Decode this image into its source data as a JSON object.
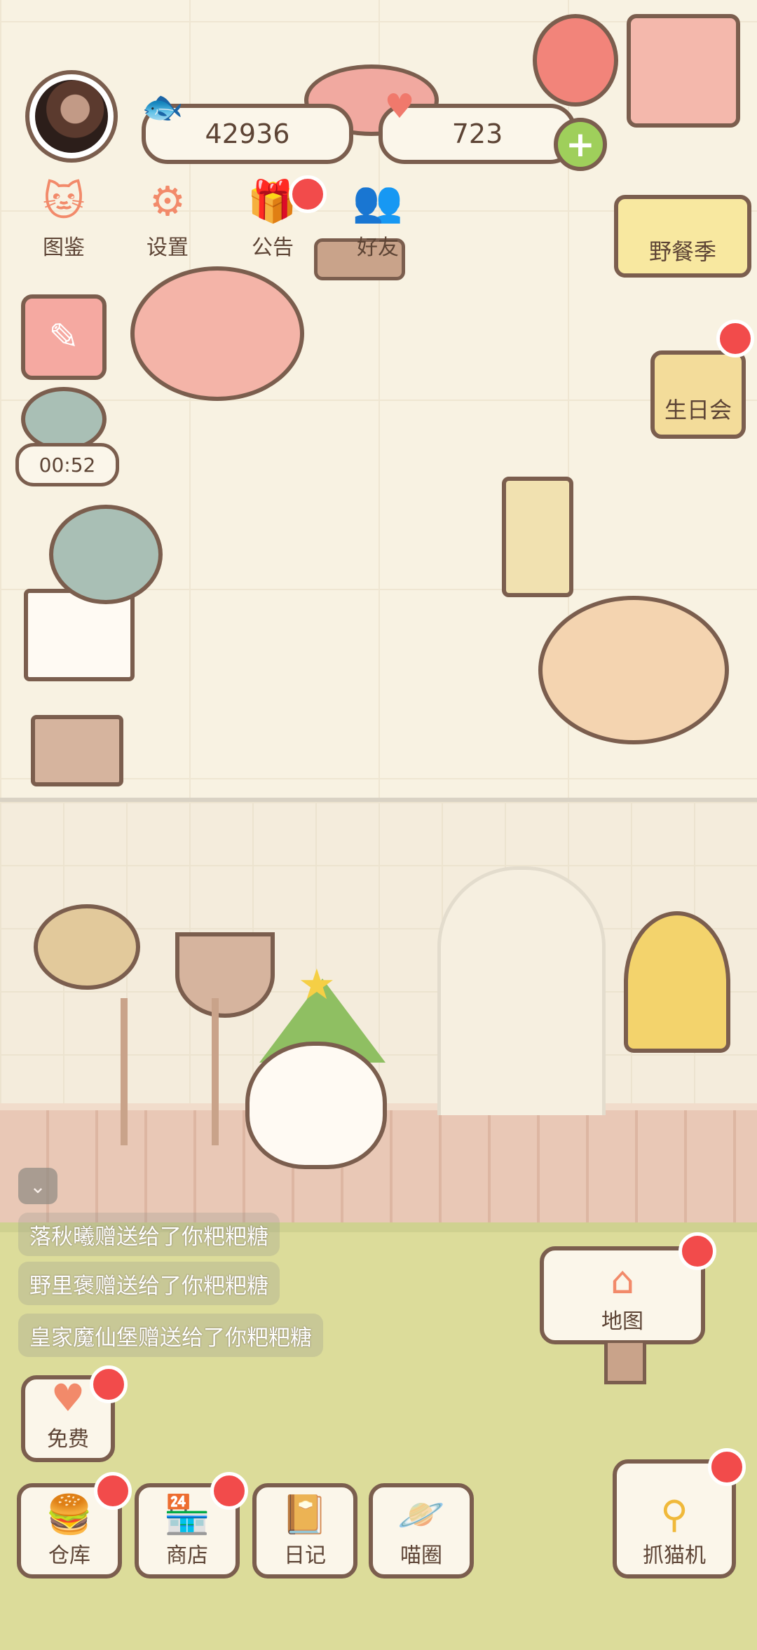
{
  "hud": {
    "fish_coins": "42936",
    "hearts": "723",
    "fish_icon": "fish-icon",
    "heart_icon": "heart-icon",
    "plus_label": "+"
  },
  "top_menu": [
    {
      "label": "图鉴",
      "icon": "cat-book-icon",
      "glyph": "🐱"
    },
    {
      "label": "设置",
      "icon": "gear-icon",
      "glyph": "⚙"
    },
    {
      "label": "公告",
      "icon": "gift-icon",
      "glyph": "🎁"
    },
    {
      "label": "好友",
      "icon": "friends-icon",
      "glyph": "👥"
    }
  ],
  "events": {
    "picnic_label": "野餐季",
    "birthday_label": "生日会"
  },
  "timer": "00:52",
  "feed": [
    "落秋曦赠送给了你粑粑糖",
    "野里褒赠送给了你粑粑糖",
    "皇家魔仙堡赠送给了你粑粑糖"
  ],
  "free_label": "免费",
  "map_label": "地图",
  "bottom_buttons": [
    {
      "label": "仓库",
      "icon": "storage-icon",
      "glyph": "🍔"
    },
    {
      "label": "商店",
      "icon": "shop-icon",
      "glyph": "🏪"
    },
    {
      "label": "日记",
      "icon": "diary-icon",
      "glyph": "📔"
    },
    {
      "label": "喵圈",
      "icon": "cat-planet-icon",
      "glyph": "🪐"
    }
  ],
  "claw_label": "抓猫机",
  "colors": {
    "outline": "#7b5e4e",
    "accent": "#f28a6a",
    "badge": "#f24b4b",
    "grass": "#dcdc9a"
  }
}
